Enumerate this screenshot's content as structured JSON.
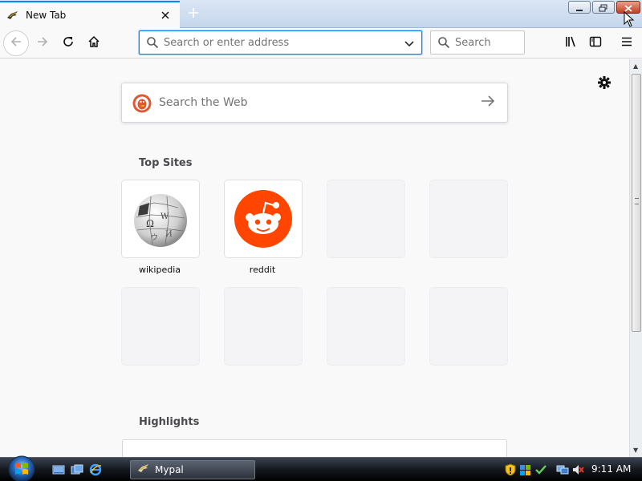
{
  "tab": {
    "title": "New Tab",
    "close_icon": "close-icon",
    "new_tab_icon": "plus-icon"
  },
  "window_controls": [
    "minimize-icon",
    "restore-icon",
    "close-icon"
  ],
  "navbar": {
    "url_placeholder": "Search or enter address",
    "search_placeholder": "Search"
  },
  "newtab": {
    "websearch_placeholder": "Search the Web",
    "top_sites_title": "Top Sites",
    "highlights_title": "Highlights",
    "top_sites": [
      {
        "label": "wikipedia"
      },
      {
        "label": "reddit"
      }
    ]
  },
  "taskbar": {
    "task_label": "Mypal",
    "clock": "9:11 AM"
  },
  "colors": {
    "accent": "#0a84ff",
    "reddit": "#ff4500",
    "ddg": "#de5833"
  }
}
